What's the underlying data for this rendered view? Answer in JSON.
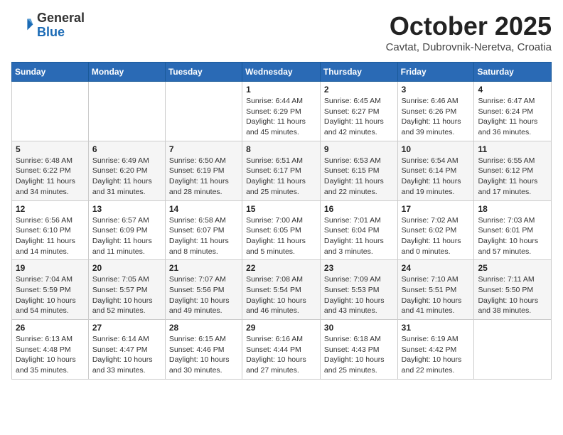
{
  "header": {
    "logo_general": "General",
    "logo_blue": "Blue",
    "month": "October 2025",
    "location": "Cavtat, Dubrovnik-Neretva, Croatia"
  },
  "weekdays": [
    "Sunday",
    "Monday",
    "Tuesday",
    "Wednesday",
    "Thursday",
    "Friday",
    "Saturday"
  ],
  "weeks": [
    [
      {
        "day": "",
        "info": ""
      },
      {
        "day": "",
        "info": ""
      },
      {
        "day": "",
        "info": ""
      },
      {
        "day": "1",
        "info": "Sunrise: 6:44 AM\nSunset: 6:29 PM\nDaylight: 11 hours\nand 45 minutes."
      },
      {
        "day": "2",
        "info": "Sunrise: 6:45 AM\nSunset: 6:27 PM\nDaylight: 11 hours\nand 42 minutes."
      },
      {
        "day": "3",
        "info": "Sunrise: 6:46 AM\nSunset: 6:26 PM\nDaylight: 11 hours\nand 39 minutes."
      },
      {
        "day": "4",
        "info": "Sunrise: 6:47 AM\nSunset: 6:24 PM\nDaylight: 11 hours\nand 36 minutes."
      }
    ],
    [
      {
        "day": "5",
        "info": "Sunrise: 6:48 AM\nSunset: 6:22 PM\nDaylight: 11 hours\nand 34 minutes."
      },
      {
        "day": "6",
        "info": "Sunrise: 6:49 AM\nSunset: 6:20 PM\nDaylight: 11 hours\nand 31 minutes."
      },
      {
        "day": "7",
        "info": "Sunrise: 6:50 AM\nSunset: 6:19 PM\nDaylight: 11 hours\nand 28 minutes."
      },
      {
        "day": "8",
        "info": "Sunrise: 6:51 AM\nSunset: 6:17 PM\nDaylight: 11 hours\nand 25 minutes."
      },
      {
        "day": "9",
        "info": "Sunrise: 6:53 AM\nSunset: 6:15 PM\nDaylight: 11 hours\nand 22 minutes."
      },
      {
        "day": "10",
        "info": "Sunrise: 6:54 AM\nSunset: 6:14 PM\nDaylight: 11 hours\nand 19 minutes."
      },
      {
        "day": "11",
        "info": "Sunrise: 6:55 AM\nSunset: 6:12 PM\nDaylight: 11 hours\nand 17 minutes."
      }
    ],
    [
      {
        "day": "12",
        "info": "Sunrise: 6:56 AM\nSunset: 6:10 PM\nDaylight: 11 hours\nand 14 minutes."
      },
      {
        "day": "13",
        "info": "Sunrise: 6:57 AM\nSunset: 6:09 PM\nDaylight: 11 hours\nand 11 minutes."
      },
      {
        "day": "14",
        "info": "Sunrise: 6:58 AM\nSunset: 6:07 PM\nDaylight: 11 hours\nand 8 minutes."
      },
      {
        "day": "15",
        "info": "Sunrise: 7:00 AM\nSunset: 6:05 PM\nDaylight: 11 hours\nand 5 minutes."
      },
      {
        "day": "16",
        "info": "Sunrise: 7:01 AM\nSunset: 6:04 PM\nDaylight: 11 hours\nand 3 minutes."
      },
      {
        "day": "17",
        "info": "Sunrise: 7:02 AM\nSunset: 6:02 PM\nDaylight: 11 hours\nand 0 minutes."
      },
      {
        "day": "18",
        "info": "Sunrise: 7:03 AM\nSunset: 6:01 PM\nDaylight: 10 hours\nand 57 minutes."
      }
    ],
    [
      {
        "day": "19",
        "info": "Sunrise: 7:04 AM\nSunset: 5:59 PM\nDaylight: 10 hours\nand 54 minutes."
      },
      {
        "day": "20",
        "info": "Sunrise: 7:05 AM\nSunset: 5:57 PM\nDaylight: 10 hours\nand 52 minutes."
      },
      {
        "day": "21",
        "info": "Sunrise: 7:07 AM\nSunset: 5:56 PM\nDaylight: 10 hours\nand 49 minutes."
      },
      {
        "day": "22",
        "info": "Sunrise: 7:08 AM\nSunset: 5:54 PM\nDaylight: 10 hours\nand 46 minutes."
      },
      {
        "day": "23",
        "info": "Sunrise: 7:09 AM\nSunset: 5:53 PM\nDaylight: 10 hours\nand 43 minutes."
      },
      {
        "day": "24",
        "info": "Sunrise: 7:10 AM\nSunset: 5:51 PM\nDaylight: 10 hours\nand 41 minutes."
      },
      {
        "day": "25",
        "info": "Sunrise: 7:11 AM\nSunset: 5:50 PM\nDaylight: 10 hours\nand 38 minutes."
      }
    ],
    [
      {
        "day": "26",
        "info": "Sunrise: 6:13 AM\nSunset: 4:48 PM\nDaylight: 10 hours\nand 35 minutes."
      },
      {
        "day": "27",
        "info": "Sunrise: 6:14 AM\nSunset: 4:47 PM\nDaylight: 10 hours\nand 33 minutes."
      },
      {
        "day": "28",
        "info": "Sunrise: 6:15 AM\nSunset: 4:46 PM\nDaylight: 10 hours\nand 30 minutes."
      },
      {
        "day": "29",
        "info": "Sunrise: 6:16 AM\nSunset: 4:44 PM\nDaylight: 10 hours\nand 27 minutes."
      },
      {
        "day": "30",
        "info": "Sunrise: 6:18 AM\nSunset: 4:43 PM\nDaylight: 10 hours\nand 25 minutes."
      },
      {
        "day": "31",
        "info": "Sunrise: 6:19 AM\nSunset: 4:42 PM\nDaylight: 10 hours\nand 22 minutes."
      },
      {
        "day": "",
        "info": ""
      }
    ]
  ]
}
